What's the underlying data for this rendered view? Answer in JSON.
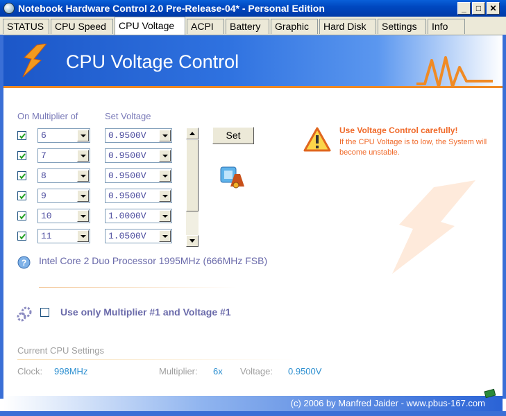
{
  "window": {
    "title": "Notebook Hardware Control 2.0 Pre-Release-04*  -  Personal Edition",
    "minimize": "_",
    "maximize": "□",
    "close": "✕"
  },
  "tabs": [
    {
      "label": "STATUS"
    },
    {
      "label": "CPU Speed"
    },
    {
      "label": "CPU Voltage",
      "active": true
    },
    {
      "label": "ACPI"
    },
    {
      "label": "Battery"
    },
    {
      "label": "Graphic"
    },
    {
      "label": "Hard Disk"
    },
    {
      "label": "Settings"
    },
    {
      "label": "Info"
    }
  ],
  "banner": {
    "title": "CPU Voltage Control"
  },
  "table": {
    "multiplier_header": "On Multiplier of",
    "voltage_header": "Set Voltage",
    "rows": [
      {
        "checked": true,
        "multiplier": "6",
        "voltage": "0.9500V"
      },
      {
        "checked": true,
        "multiplier": "7",
        "voltage": "0.9500V"
      },
      {
        "checked": true,
        "multiplier": "8",
        "voltage": "0.9500V"
      },
      {
        "checked": true,
        "multiplier": "9",
        "voltage": "0.9500V"
      },
      {
        "checked": true,
        "multiplier": "10",
        "voltage": "1.0000V"
      },
      {
        "checked": true,
        "multiplier": "11",
        "voltage": "1.0500V"
      }
    ]
  },
  "set_button": "Set",
  "warning": {
    "title": "Use Voltage Control carefully!",
    "text": "If the CPU Voltage is to low, the System will become unstable."
  },
  "processor": "Intel Core 2 Duo Processor 1995MHz (666MHz FSB)",
  "option": {
    "label": "Use only Multiplier #1 and Voltage #1",
    "checked": false
  },
  "current": {
    "title": "Current CPU Settings",
    "clock_label": "Clock:",
    "clock_value": "998MHz",
    "multiplier_label": "Multiplier:",
    "multiplier_value": "6x",
    "voltage_label": "Voltage:",
    "voltage_value": "0.9500V"
  },
  "footer": "(c) 2006 by Manfred Jaider  -  www.pbus-167.com",
  "colors": {
    "accent_orange": "#f08a24",
    "title_blue": "#0048c0",
    "value_blue": "#2c8fd0",
    "label_purple": "#6a6aaa"
  }
}
